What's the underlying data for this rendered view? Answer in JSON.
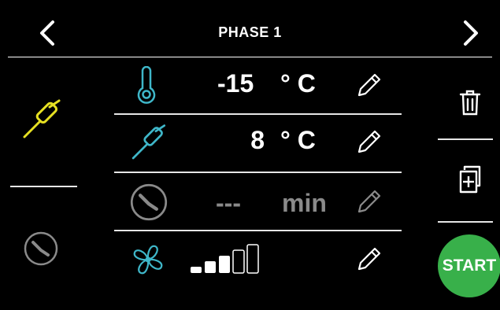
{
  "header": {
    "title": "PHASE 1",
    "prev_icon": "chevron-left-icon",
    "next_icon": "chevron-right-icon"
  },
  "sidebar": {
    "items": [
      {
        "icon": "core-probe-icon",
        "color": "#e6e022",
        "selected": true
      },
      {
        "icon": "clock-icon",
        "color": "#8a8a8a",
        "selected": false
      }
    ]
  },
  "params": [
    {
      "icon": "thermometer-icon",
      "value": "-15",
      "unit": "° C",
      "icon_color": "#3fb7c9"
    },
    {
      "icon": "core-probe-icon",
      "value": "8",
      "unit": "° C",
      "icon_color": "#3fb7c9"
    },
    {
      "icon": "clock-icon",
      "value": "---",
      "unit": "min",
      "icon_color": "#8a8a8a",
      "disabled": true
    },
    {
      "icon": "fan-icon",
      "value": "",
      "unit": "",
      "icon_color": "#3fb7c9",
      "fan_speed": {
        "level": 3,
        "max": 5
      }
    }
  ],
  "actions": {
    "delete_icon": "trash-icon",
    "duplicate_icon": "duplicate-add-icon",
    "start_label": "START"
  },
  "colors": {
    "accent": "#3fb7c9",
    "probe_selected": "#e6e022",
    "disabled": "#8a8a8a",
    "start": "#38b04a"
  }
}
